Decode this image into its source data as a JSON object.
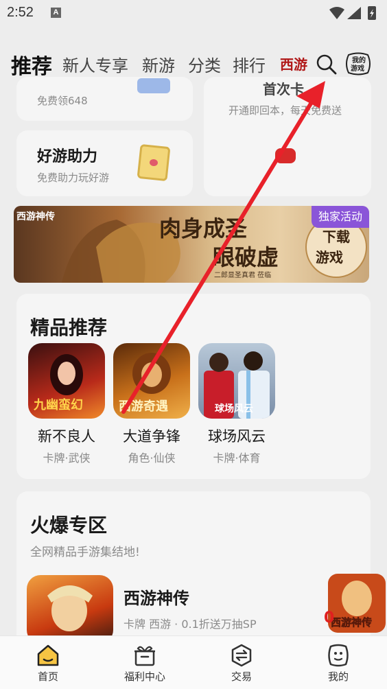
{
  "status": {
    "time": "2:52",
    "notif_glyph": "A"
  },
  "nav": {
    "tabs": [
      "推荐",
      "新人专享",
      "新游",
      "分类",
      "排行"
    ],
    "logo_text": "西游",
    "mygames": [
      "我的",
      "游戏"
    ]
  },
  "cards": {
    "top_left_sub": "免费领648",
    "top_right_title": "首次卡",
    "top_right_sub": "开通即回本，每天免费送",
    "help_title": "好游助力",
    "help_sub": "免费助力玩好游"
  },
  "banner": {
    "logo": "西游神传",
    "headline1": "肉身成圣",
    "headline2": "眼破虚",
    "cta": [
      "下载",
      "游戏"
    ],
    "badge": "独家活动",
    "caption": "二郎显圣真君 莅临"
  },
  "featured": {
    "title": "精品推荐",
    "games": [
      {
        "name": "新不良人",
        "tags": "卡牌·武侠",
        "art_text": "九幽蛮幻"
      },
      {
        "name": "大道争锋",
        "tags": "角色·仙侠",
        "art_text": "西游奇遇"
      },
      {
        "name": "球场风云",
        "tags": "卡牌·体育",
        "art_text": "球场风云"
      }
    ]
  },
  "hot": {
    "title": "火爆专区",
    "subtitle": "全网精品手游集结地!",
    "game_name": "西游神传",
    "game_desc": "卡牌 西游 · 0.1折送万抽SP"
  },
  "float": {
    "zero": "0",
    "text": "西游神传"
  },
  "bottom_nav": [
    {
      "label": "首页",
      "icon": "home-icon"
    },
    {
      "label": "福利中心",
      "icon": "gift-icon"
    },
    {
      "label": "交易",
      "icon": "trade-icon"
    },
    {
      "label": "我的",
      "icon": "profile-icon"
    }
  ],
  "colors": {
    "accent_red": "#e8212a",
    "badge_purple": "#8a55d8",
    "background": "#ededed"
  }
}
